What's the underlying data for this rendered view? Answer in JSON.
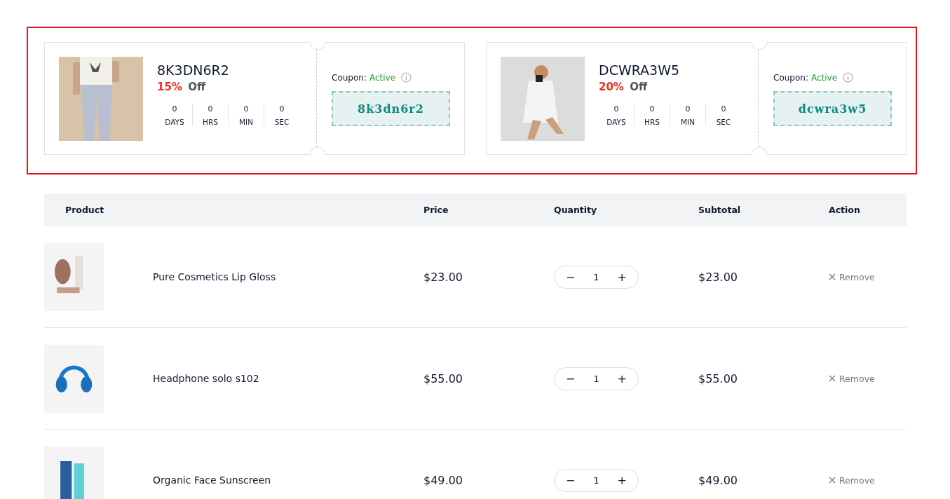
{
  "coupons": [
    {
      "code": "8K3DN6R2",
      "discount": "15%",
      "discount_suffix": "Off",
      "countdown": [
        {
          "value": "0",
          "unit": "DAYS"
        },
        {
          "value": "0",
          "unit": "HRS"
        },
        {
          "value": "0",
          "unit": "MIN"
        },
        {
          "value": "0",
          "unit": "SEC"
        }
      ],
      "status_label": "Coupon:",
      "status": "Active",
      "coupon_code": "8k3dn6r2"
    },
    {
      "code": "DCWRA3W5",
      "discount": "20%",
      "discount_suffix": "Off",
      "countdown": [
        {
          "value": "0",
          "unit": "DAYS"
        },
        {
          "value": "0",
          "unit": "HRS"
        },
        {
          "value": "0",
          "unit": "MIN"
        },
        {
          "value": "0",
          "unit": "SEC"
        }
      ],
      "status_label": "Coupon:",
      "status": "Active",
      "coupon_code": "dcwra3w5"
    }
  ],
  "table": {
    "columns": [
      "Product",
      "Price",
      "Quantity",
      "Subtotal",
      "Action"
    ],
    "rows": [
      {
        "product": "Pure Cosmetics Lip Gloss",
        "price": "$23.00",
        "quantity": "1",
        "decrement": "−",
        "increment": "+",
        "subtotal": "$23.00",
        "action": "Remove"
      },
      {
        "product": "Headphone solo s102",
        "price": "$55.00",
        "quantity": "1",
        "decrement": "−",
        "increment": "+",
        "subtotal": "$55.00",
        "action": "Remove"
      },
      {
        "product": "Organic Face Sunscreen",
        "price": "$49.00",
        "quantity": "1",
        "decrement": "−",
        "increment": "+",
        "subtotal": "$49.00",
        "action": "Remove"
      }
    ]
  }
}
